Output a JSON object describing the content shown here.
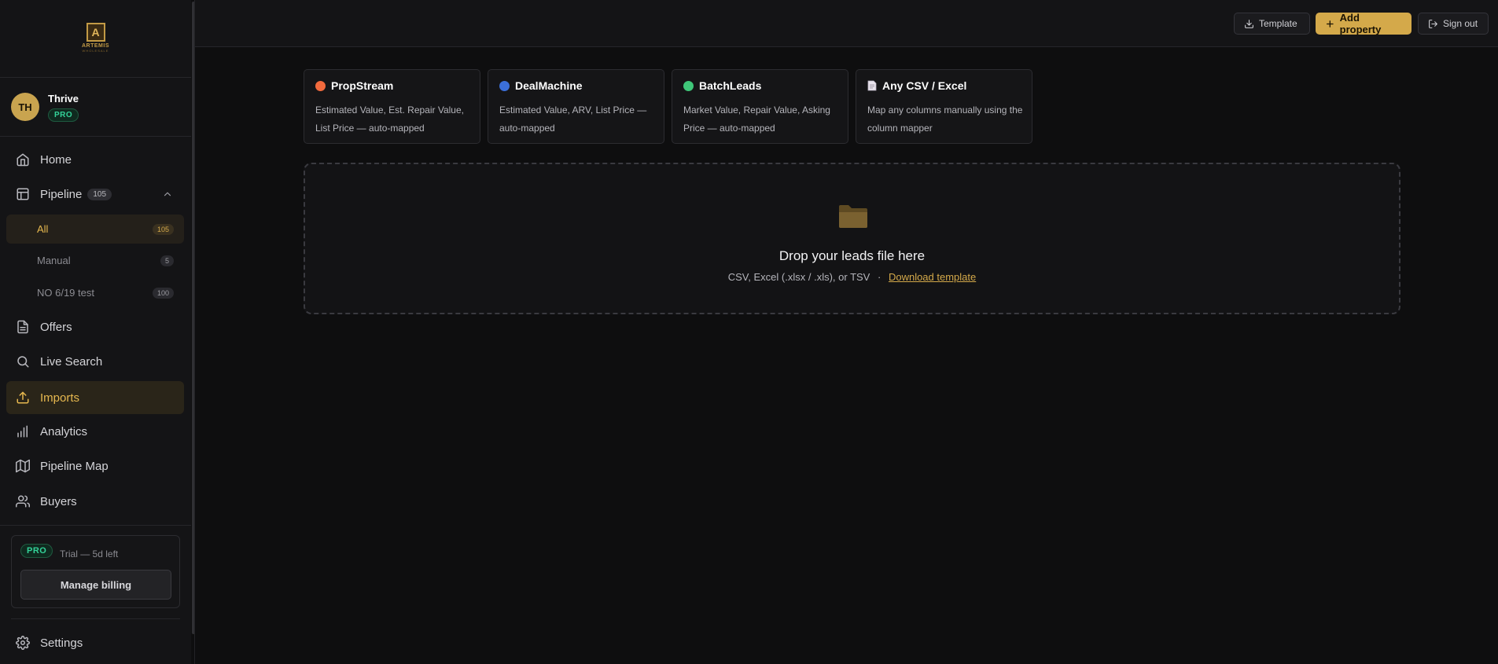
{
  "brand": {
    "logo_text": "ARTEMIS",
    "logo_sub": "WHOLESALE"
  },
  "user": {
    "initials": "TH",
    "name": "Thrive",
    "plan": "PRO"
  },
  "nav": {
    "home": "Home",
    "pipeline": {
      "label": "Pipeline",
      "count": "105"
    },
    "pipeline_sub": [
      {
        "label": "All",
        "count": "105"
      },
      {
        "label": "Manual",
        "count": "5"
      },
      {
        "label": "NO 6/19 test",
        "count": "100"
      }
    ],
    "offers": "Offers",
    "live_search": "Live Search",
    "imports": "Imports",
    "analytics": "Analytics",
    "pipeline_map": "Pipeline Map",
    "buyers": "Buyers",
    "settings": "Settings"
  },
  "billing": {
    "plan": "PRO",
    "trial": "Trial — 5d left",
    "button": "Manage billing"
  },
  "topbar": {
    "template": "Template",
    "add_property": "Add property",
    "sign_out": "Sign out"
  },
  "sources": [
    {
      "name": "PropStream",
      "desc": "Estimated Value, Est. Repair Value, List Price — auto-mapped",
      "color": "#f26a3d"
    },
    {
      "name": "DealMachine",
      "desc": "Estimated Value, ARV, List Price — auto-mapped",
      "color": "#3b6fd9"
    },
    {
      "name": "BatchLeads",
      "desc": "Market Value, Repair Value, Asking Price — auto-mapped",
      "color": "#3fc779"
    },
    {
      "name": "Any CSV / Excel",
      "desc": "Map any columns manually using the column mapper",
      "icon": "document-icon"
    }
  ],
  "dropzone": {
    "title": "Drop your leads file here",
    "formats": "CSV, Excel (.xlsx / .xls), or TSV",
    "separator": "·",
    "link": "Download template"
  },
  "colors": {
    "accent": "#d4a94a",
    "background": "#0e0e0f",
    "sidebar": "#141416",
    "pro_green": "#34d399"
  }
}
